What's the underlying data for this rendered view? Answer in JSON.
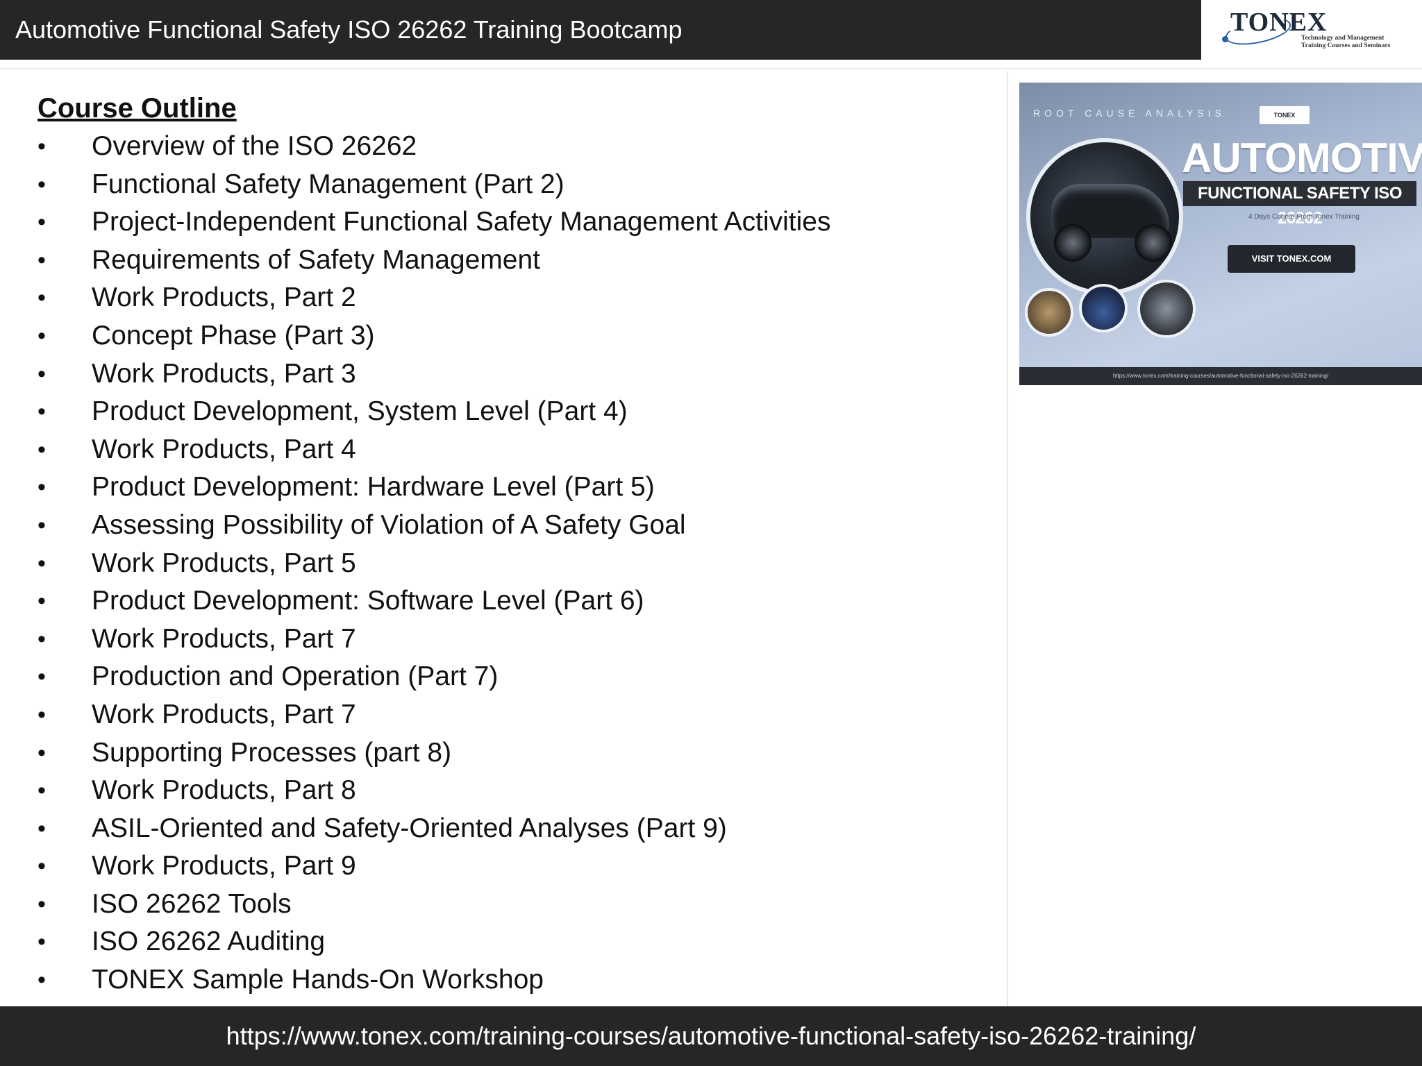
{
  "header": {
    "title": "Automotive Functional Safety ISO 26262 Training Bootcamp"
  },
  "logo": {
    "name": "TONEX",
    "tagline_line1": "Technology and Management",
    "tagline_line2": "Training Courses and Seminars"
  },
  "outline": {
    "heading": "Course Outline",
    "bullet_glyph": "•",
    "items": [
      "Overview of the ISO 26262",
      "Functional Safety Management (Part 2)",
      "Project-Independent Functional Safety Management Activities",
      "Requirements of Safety Management",
      "Work Products, Part 2",
      "Concept Phase (Part 3)",
      "Work Products, Part 3",
      "Product Development, System Level (Part 4)",
      "Work Products, Part 4",
      "Product Development: Hardware Level (Part 5)",
      "Assessing Possibility of Violation of A Safety Goal",
      "Work Products, Part 5",
      "Product Development: Software Level (Part 6)",
      "Work Products, Part 7",
      "Production and Operation (Part 7)",
      "Work Products, Part 7",
      "Supporting Processes (part 8)",
      "Work Products, Part 8",
      "ASIL-Oriented and Safety-Oriented Analyses (Part 9)",
      "Work Products, Part 9",
      "ISO 26262 Tools",
      "ISO 26262 Auditing",
      "TONEX Sample Hands-On Workshop"
    ]
  },
  "promo": {
    "top_text": "ROOT CAUSE ANALYSIS",
    "mini_logo": "TONEX",
    "title": "AUTOMOTIVE",
    "subtitle": "FUNCTIONAL SAFETY ISO 26262",
    "small_text": "4 Days Course From Tonex Training",
    "button_label": "VISIT TONEX.COM",
    "footer_url": "https://www.tonex.com/training-courses/automotive-functional-safety-iso-26262-training/"
  },
  "footer": {
    "url": "https://www.tonex.com/training-courses/automotive-functional-safety-iso-26262-training/"
  },
  "colors": {
    "bar_background": "#262626",
    "text_light": "#ffffff",
    "text_dark": "#111111",
    "brand_blue": "#2a5fa8"
  }
}
